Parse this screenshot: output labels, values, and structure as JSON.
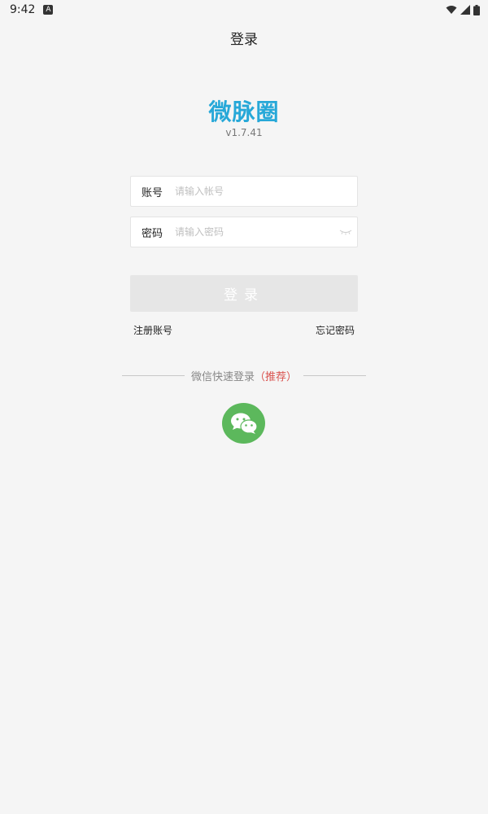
{
  "status_bar": {
    "time": "9:42",
    "notification_badge": "A",
    "icons": [
      "wifi-icon",
      "signal-icon",
      "battery-icon"
    ]
  },
  "header": {
    "title": "登录"
  },
  "brand": {
    "name": "微脉圈",
    "version": "v1.7.41",
    "color": "#27a8d8"
  },
  "form": {
    "account": {
      "label": "账号",
      "placeholder": "请输入帐号",
      "value": ""
    },
    "password": {
      "label": "密码",
      "placeholder": "请输入密码",
      "value": ""
    },
    "login_label": "登录"
  },
  "links": {
    "register": "注册账号",
    "forgot": "忘记密码"
  },
  "quick_login": {
    "text": "微信快速登录",
    "recommend": "（推荐）",
    "icon": "wechat-icon",
    "color": "#5cb85c"
  }
}
